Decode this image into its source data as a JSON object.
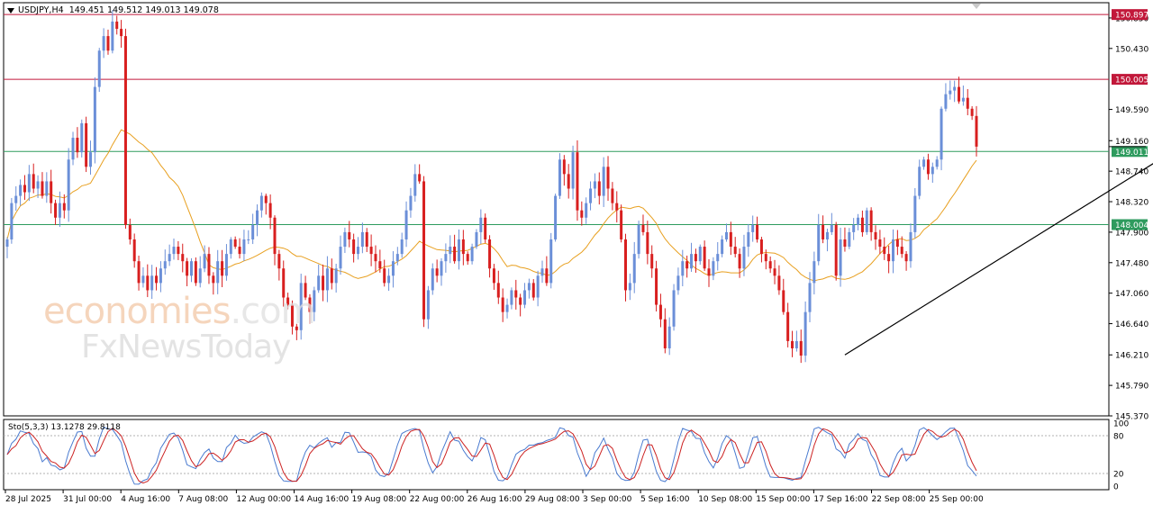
{
  "header": {
    "symbol": "USDJPY,H4",
    "ohlc": "149.451 149.512 149.013 149.078"
  },
  "stochastic_label": "Sto(5,3,3) 13.1278 29.8118",
  "watermark": {
    "line1_main": "economies",
    "line1_suffix": ".com",
    "line2": "FxNewsToday"
  },
  "colors": {
    "bull": "#6b8fd8",
    "bear": "#d81f1f",
    "ma": "#e8a020",
    "resistance": "#c2183a",
    "support": "#2e9b5e",
    "trendline": "#000000",
    "stoch_main": "#4a7bd0",
    "stoch_signal": "#cc2222"
  },
  "chart_data": {
    "type": "candlestick",
    "symbol": "USDJPY",
    "timeframe": "H4",
    "y_axis": {
      "min": 145.37,
      "max": 151.06,
      "ticks": [
        "150.850",
        "150.430",
        "149.590",
        "149.160",
        "148.740",
        "148.320",
        "147.900",
        "147.480",
        "147.060",
        "146.640",
        "146.210",
        "145.790",
        "145.370"
      ]
    },
    "x_axis_labels": [
      "28 Jul 2025",
      "31 Jul 00:00",
      "4 Aug 16:00",
      "7 Aug 08:00",
      "12 Aug 00:00",
      "14 Aug 16:00",
      "19 Aug 08:00",
      "22 Aug 00:00",
      "26 Aug 16:00",
      "29 Aug 08:00",
      "3 Sep 00:00",
      "5 Sep 16:00",
      "10 Sep 08:00",
      "15 Sep 00:00",
      "17 Sep 16:00",
      "22 Sep 08:00",
      "25 Sep 00:00"
    ],
    "horizontal_levels": [
      {
        "value": 150.897,
        "label": "150.897",
        "kind": "resistance"
      },
      {
        "value": 150.005,
        "label": "150.005",
        "kind": "resistance"
      },
      {
        "value": 149.011,
        "label": "149.011",
        "kind": "support"
      },
      {
        "value": 148.004,
        "label": "148.004",
        "kind": "support"
      }
    ],
    "current_price": 149.078,
    "trendline": {
      "start": [
        191,
        146.21
      ],
      "end": [
        282,
        149.62
      ]
    },
    "closes": [
      147.8,
      148.3,
      148.4,
      148.55,
      148.45,
      148.7,
      148.5,
      148.6,
      148.4,
      148.6,
      148.3,
      148.1,
      148.3,
      148.2,
      148.9,
      149.2,
      149.0,
      149.4,
      148.8,
      149.0,
      149.9,
      150.4,
      150.6,
      150.4,
      150.8,
      150.7,
      150.6,
      148.0,
      147.8,
      147.5,
      147.2,
      147.3,
      147.1,
      147.3,
      147.2,
      147.4,
      147.5,
      147.6,
      147.7,
      147.6,
      147.5,
      147.3,
      147.5,
      147.2,
      147.4,
      147.6,
      147.3,
      147.2,
      147.5,
      147.3,
      147.6,
      147.8,
      147.7,
      147.6,
      147.8,
      147.8,
      148.0,
      148.2,
      148.4,
      148.3,
      148.1,
      147.6,
      147.4,
      147.0,
      146.9,
      146.6,
      146.55,
      147.2,
      147.0,
      146.8,
      147.1,
      147.3,
      147.1,
      147.4,
      147.2,
      147.4,
      147.7,
      147.9,
      147.8,
      147.6,
      147.7,
      147.9,
      147.7,
      147.6,
      147.5,
      147.4,
      147.2,
      147.3,
      147.5,
      147.6,
      147.8,
      148.2,
      148.4,
      148.7,
      148.6,
      146.7,
      147.1,
      147.4,
      147.3,
      147.5,
      147.6,
      147.7,
      147.5,
      147.8,
      147.6,
      147.5,
      147.7,
      147.9,
      148.1,
      147.8,
      147.4,
      147.2,
      147.0,
      146.8,
      146.9,
      147.1,
      147.0,
      146.9,
      147.1,
      147.2,
      147.0,
      147.3,
      147.4,
      147.2,
      147.8,
      148.4,
      148.9,
      148.7,
      148.5,
      149.0,
      148.2,
      148.1,
      148.3,
      148.5,
      148.6,
      148.4,
      148.8,
      148.5,
      148.3,
      148.2,
      147.8,
      147.1,
      147.2,
      147.6,
      148.0,
      147.9,
      147.6,
      147.4,
      146.9,
      146.7,
      146.3,
      146.6,
      147.1,
      147.3,
      147.5,
      147.4,
      147.6,
      147.5,
      147.7,
      147.4,
      147.3,
      147.5,
      147.6,
      147.8,
      147.9,
      147.7,
      147.6,
      147.4,
      147.7,
      147.9,
      148.0,
      147.8,
      147.6,
      147.5,
      147.4,
      147.3,
      147.1,
      146.8,
      146.4,
      146.3,
      146.4,
      146.2,
      146.8,
      147.2,
      147.5,
      148.0,
      147.8,
      147.9,
      148.0,
      147.3,
      147.8,
      147.7,
      147.9,
      148.0,
      148.1,
      147.9,
      148.2,
      147.9,
      147.8,
      147.7,
      147.6,
      147.5,
      147.8,
      147.7,
      147.6,
      147.5,
      147.9,
      148.4,
      148.8,
      148.9,
      148.7,
      148.8,
      148.9,
      149.6,
      149.8,
      149.85,
      149.9,
      149.7,
      149.75,
      149.6,
      149.5,
      149.078
    ]
  }
}
